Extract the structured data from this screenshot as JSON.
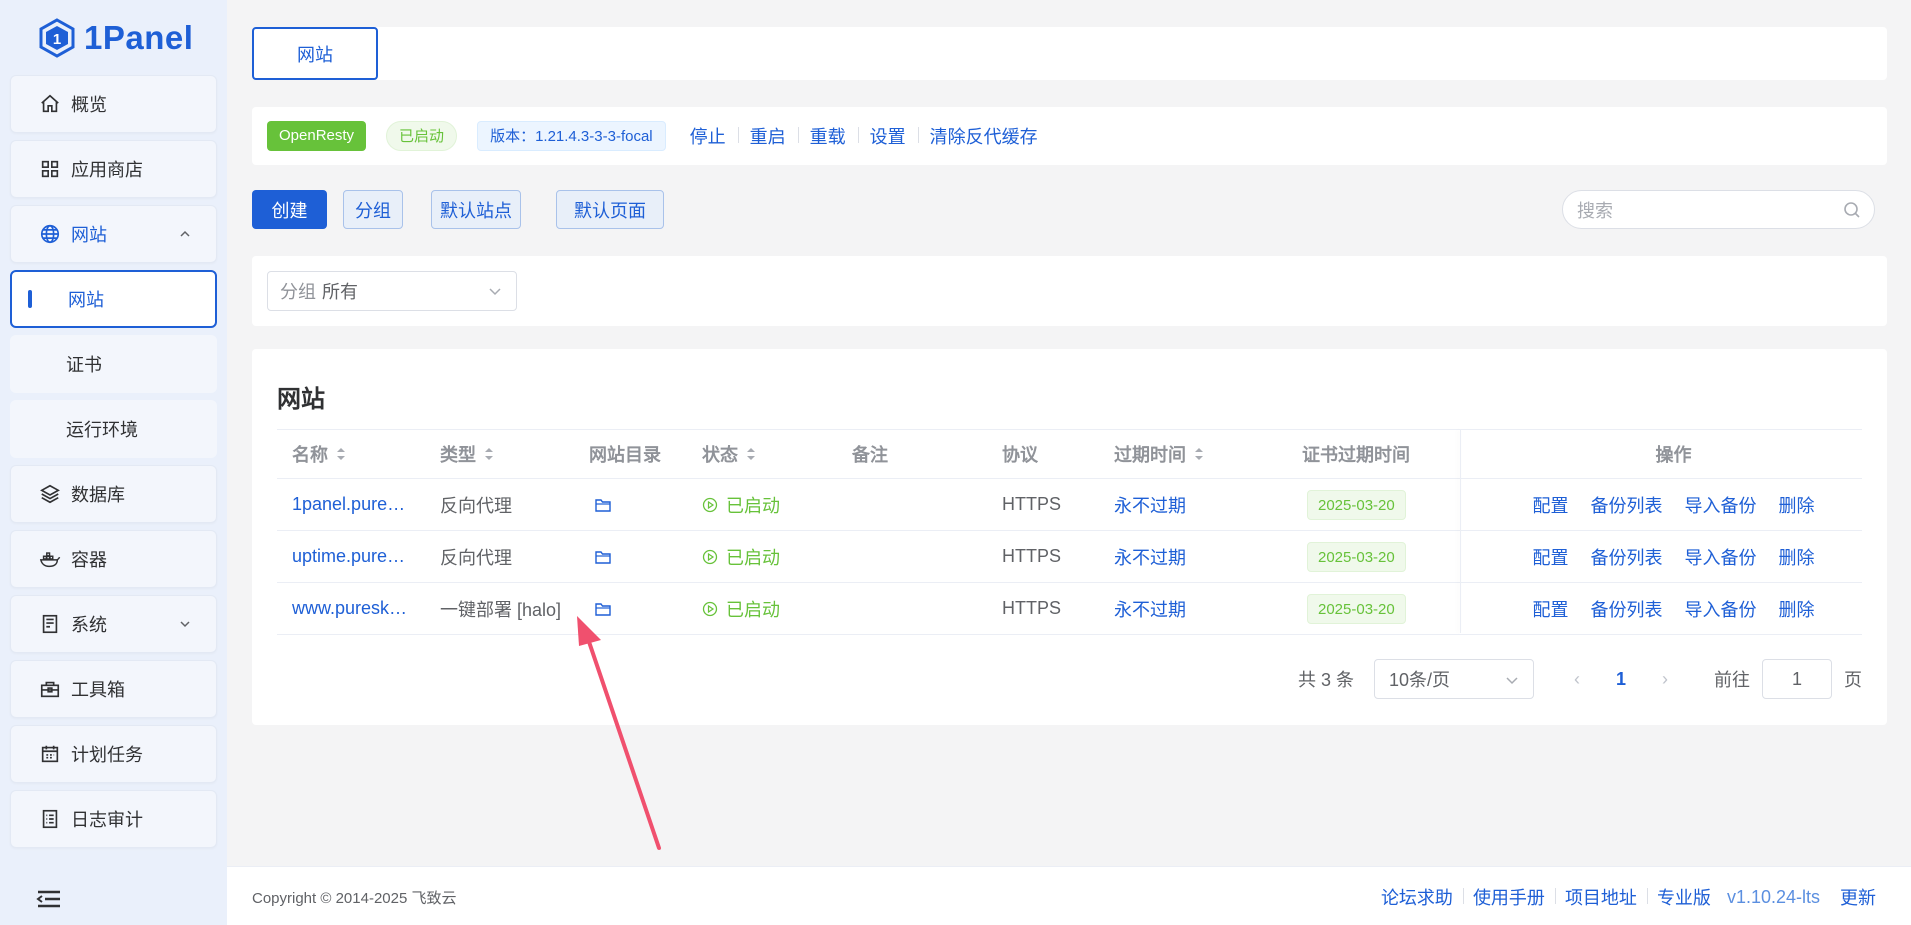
{
  "brand": {
    "name": "1Panel"
  },
  "sidebar": {
    "items": [
      {
        "label": "概览",
        "icon": "home-icon"
      },
      {
        "label": "应用商店",
        "icon": "apps-icon"
      },
      {
        "label": "网站",
        "icon": "globe-icon",
        "expanded": true,
        "children": [
          {
            "label": "网站",
            "active": true
          },
          {
            "label": "证书"
          },
          {
            "label": "运行环境"
          }
        ]
      },
      {
        "label": "数据库",
        "icon": "layers-icon"
      },
      {
        "label": "容器",
        "icon": "docker-icon"
      },
      {
        "label": "系统",
        "icon": "server-icon",
        "expandable": true
      },
      {
        "label": "工具箱",
        "icon": "toolbox-icon"
      },
      {
        "label": "计划任务",
        "icon": "calendar-icon"
      },
      {
        "label": "日志审计",
        "icon": "log-icon"
      }
    ]
  },
  "tabs": {
    "active": "网站"
  },
  "app": {
    "name": "OpenResty",
    "status": "已启动",
    "version": "版本：1.21.4.3-3-3-focal",
    "actions": [
      "停止",
      "重启",
      "重载",
      "设置",
      "清除反代缓存"
    ]
  },
  "toolbar": {
    "create": "创建",
    "group": "分组",
    "default_site": "默认站点",
    "default_page": "默认页面",
    "search_placeholder": "搜索"
  },
  "filter": {
    "prefix": "分组",
    "value": "所有"
  },
  "table": {
    "title": "网站",
    "columns": [
      "名称",
      "类型",
      "网站目录",
      "状态",
      "备注",
      "协议",
      "过期时间",
      "证书过期时间",
      "操作"
    ],
    "rows": [
      {
        "name": "1panel.pure…",
        "type": "反向代理",
        "status": "已启动",
        "remark": "",
        "protocol": "HTTPS",
        "expire": "永不过期",
        "cert_expire": "2025-03-20"
      },
      {
        "name": "uptime.pure…",
        "type": "反向代理",
        "status": "已启动",
        "remark": "",
        "protocol": "HTTPS",
        "expire": "永不过期",
        "cert_expire": "2025-03-20"
      },
      {
        "name": "www.puresk…",
        "type": "一键部署 [halo]",
        "status": "已启动",
        "remark": "",
        "protocol": "HTTPS",
        "expire": "永不过期",
        "cert_expire": "2025-03-20"
      }
    ],
    "row_actions": [
      "配置",
      "备份列表",
      "导入备份",
      "删除"
    ]
  },
  "pagination": {
    "total": "共 3 条",
    "page_size": "10条/页",
    "current": "1",
    "goto_label": "前往",
    "goto_value": "1",
    "page_suffix": "页"
  },
  "footer": {
    "copyright": "Copyright © 2014-2025 飞致云",
    "links": [
      "论坛求助",
      "使用手册",
      "项目地址",
      "专业版"
    ],
    "version": "v1.10.24-lts",
    "update": "更新"
  },
  "colors": {
    "primary": "#1e5fd6",
    "success": "#67c23a",
    "annotation_arrow": "#f0506e"
  }
}
